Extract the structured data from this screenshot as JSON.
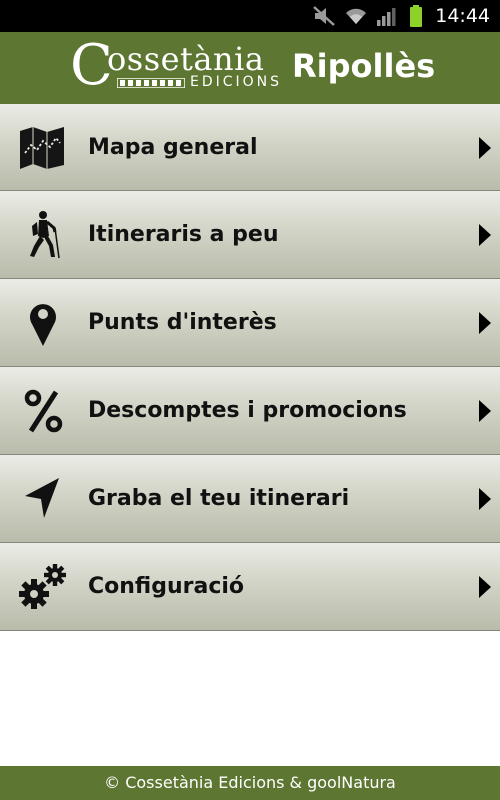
{
  "status_bar": {
    "time": "14:44",
    "icons": [
      "mute-icon",
      "wifi-icon",
      "signal-icon",
      "battery-icon"
    ]
  },
  "header": {
    "brand_initial": "C",
    "brand_word": "ossetània",
    "brand_sub": "EDICIONS",
    "region": "Ripollès"
  },
  "menu": {
    "items": [
      {
        "label": "Mapa general",
        "icon": "map-icon"
      },
      {
        "label": "Itineraris a peu",
        "icon": "hiker-icon"
      },
      {
        "label": "Punts d'interès",
        "icon": "location-pin-icon"
      },
      {
        "label": "Descomptes i promocions",
        "icon": "percent-icon"
      },
      {
        "label": "Graba el teu itinerari",
        "icon": "navigation-arrow-icon"
      },
      {
        "label": "Configuració",
        "icon": "gears-icon"
      }
    ]
  },
  "footer": {
    "text": "© Cossetània Edicions & goolNatura"
  },
  "colors": {
    "header_bg": "#5d7632",
    "footer_bg": "#5d7632",
    "menu_gradient_top": "#ebece6",
    "menu_gradient_bottom": "#b9bcab",
    "label_text": "#111111"
  }
}
